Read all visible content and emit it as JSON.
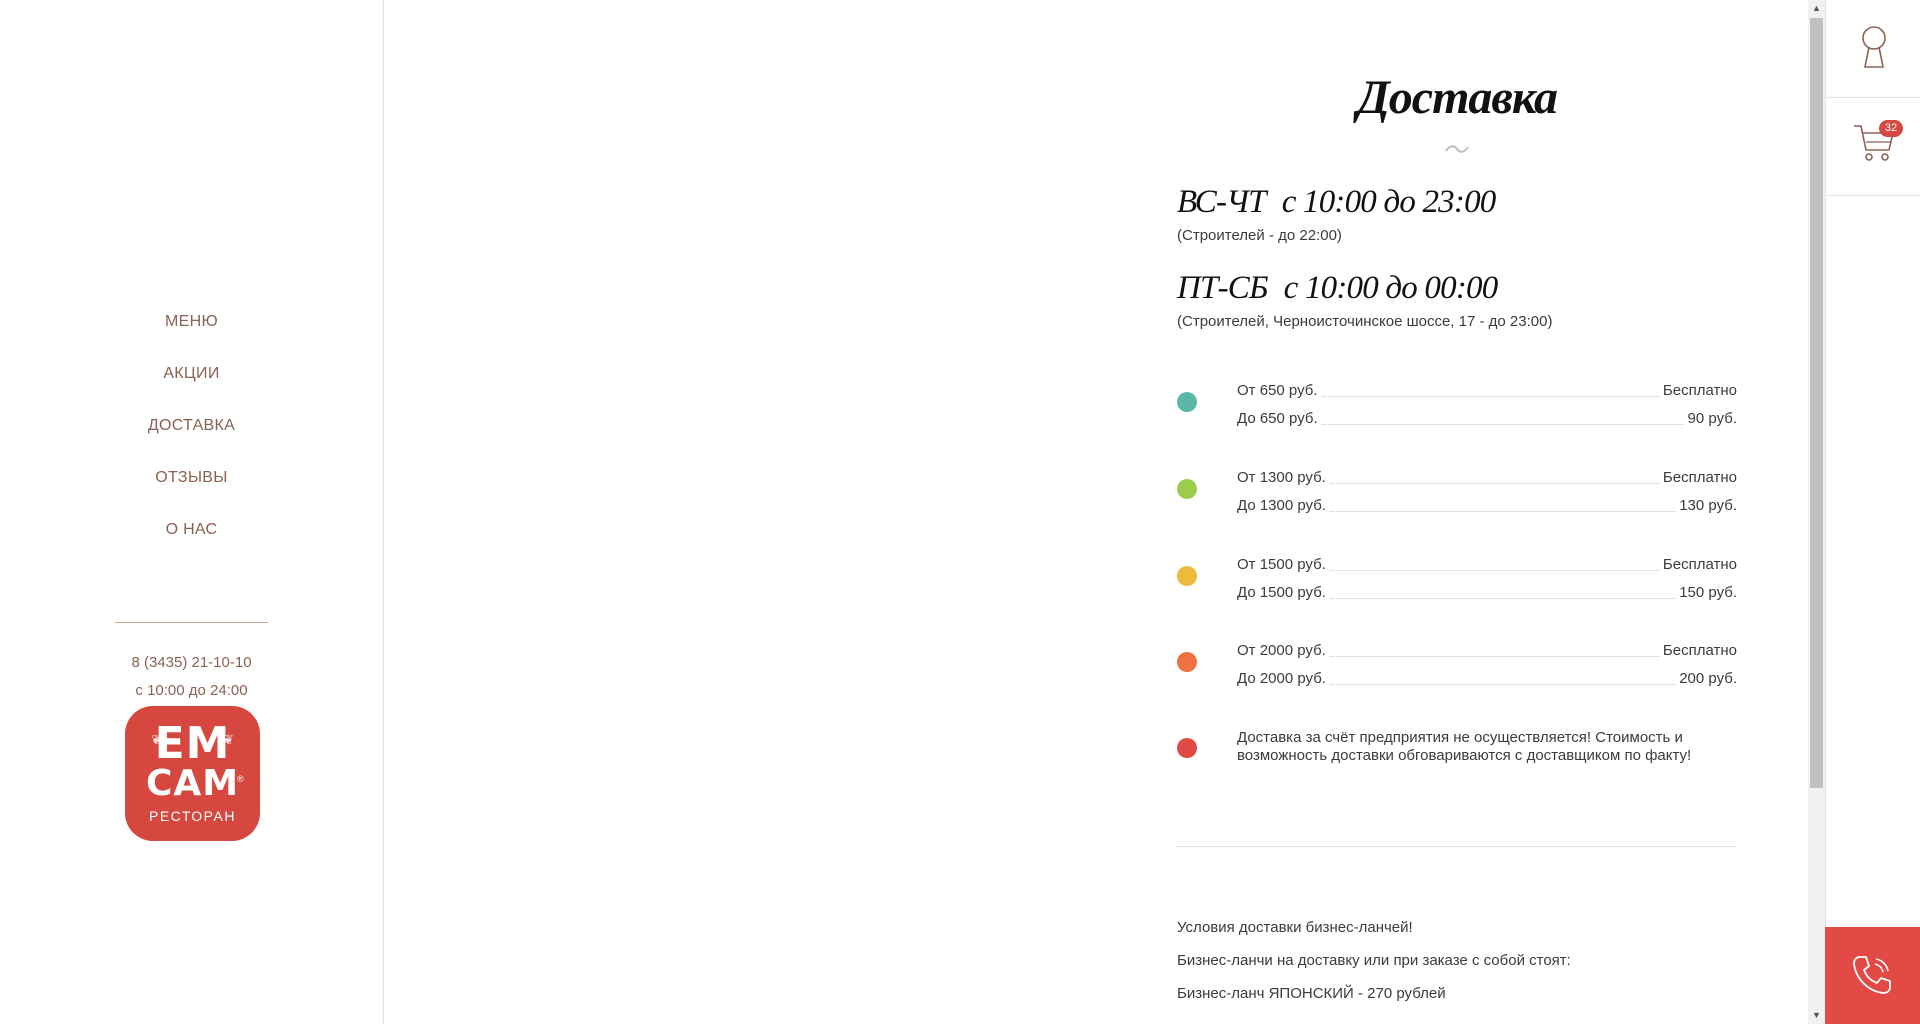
{
  "sidebar": {
    "nav": [
      "МЕНЮ",
      "АКЦИИ",
      "ДОСТАВКА",
      "ОТЗЫВЫ",
      "О НАС"
    ],
    "phone": "8 (3435) 21-10-10",
    "hours": "с 10:00 до 24:00",
    "logo": {
      "line1": "EM",
      "line2": "CAM",
      "sub": "РЕСТОРАН",
      "reg": "®"
    }
  },
  "main": {
    "title": "Доставка",
    "ornament": "~",
    "schedules": [
      {
        "days": "ВС-ЧТ",
        "time": "с 10:00 до 23:00",
        "note": "(Строителей - до 22:00)"
      },
      {
        "days": "ПТ-СБ",
        "time": "с 10:00 до 00:00",
        "note": "(Строителей, Черноисточинское шоссе, 17 - до 23:00)"
      }
    ],
    "tiers": [
      {
        "color": "#5bb8a6",
        "rows": [
          {
            "label": "От 650 руб.",
            "value": "Бесплатно"
          },
          {
            "label": "До 650 руб.",
            "value": "90 руб."
          }
        ]
      },
      {
        "color": "#9ccc4e",
        "rows": [
          {
            "label": "От 1300 руб.",
            "value": "Бесплатно"
          },
          {
            "label": "До 1300 руб.",
            "value": "130 руб."
          }
        ]
      },
      {
        "color": "#f0b93f",
        "rows": [
          {
            "label": "От 1500 руб.",
            "value": "Бесплатно"
          },
          {
            "label": "До 1500 руб.",
            "value": "150 руб."
          }
        ]
      },
      {
        "color": "#ef7040",
        "rows": [
          {
            "label": "От 2000 руб.",
            "value": "Бесплатно"
          },
          {
            "label": "До 2000 руб.",
            "value": "200 руб."
          }
        ]
      }
    ],
    "note": {
      "color": "#e04a45",
      "text": "Доставка за счёт предприятия не осуществляется! Стоимость и возможность доставки обговариваются с доставщиком по факту!"
    },
    "paragraphs": [
      "Условия доставки бизнес-ланчей!",
      "Бизнес-ланчи на доставку или при заказе с собой стоят:",
      "Бизнес-ланч ЯПОНСКИЙ - 270 рублей"
    ]
  },
  "rail": {
    "cart_count": "32",
    "icons": [
      "keyhole-icon",
      "cart-icon",
      "phone-icon"
    ],
    "colors": {
      "accent": "#e34a45",
      "icon_stroke": "#8a6253"
    }
  },
  "scroll": {
    "up": "▲",
    "down": "▼"
  }
}
